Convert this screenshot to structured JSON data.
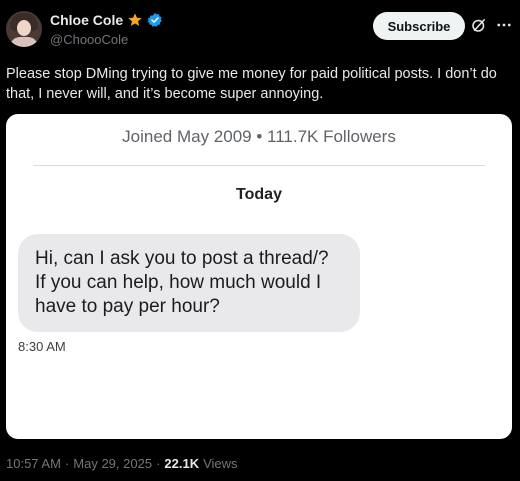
{
  "author": {
    "display_name": "Chloe Cole",
    "handle": "@ChoooCole"
  },
  "header": {
    "subscribe_label": "Subscribe"
  },
  "post": {
    "text": "Please stop DMing trying to give me money for paid political posts. I don’t do that, I never will, and it’s become super annoying."
  },
  "screenshot": {
    "joined_line": "Joined May 2009 • 111.7K Followers",
    "day_label": "Today",
    "message_text": "Hi, can I ask you to post a thread/? If you can help, how much would I have to pay per hour?",
    "message_time": "8:30 AM"
  },
  "footer": {
    "time": "10:57 AM",
    "separator1": "·",
    "date": "May 29, 2025",
    "separator2": "·",
    "views_count": "22.1K",
    "views_label": "Views"
  },
  "icons": {
    "star": "star-icon",
    "verified": "verified-badge-icon",
    "grok": "grok-icon",
    "more": "more-icon"
  },
  "colors": {
    "background": "#000000",
    "text_primary": "#e7e9ea",
    "text_secondary": "#71767b",
    "verified_blue": "#1d9bf0",
    "star_gold": "#f5a623",
    "bubble_gray": "#e9e9eb"
  }
}
